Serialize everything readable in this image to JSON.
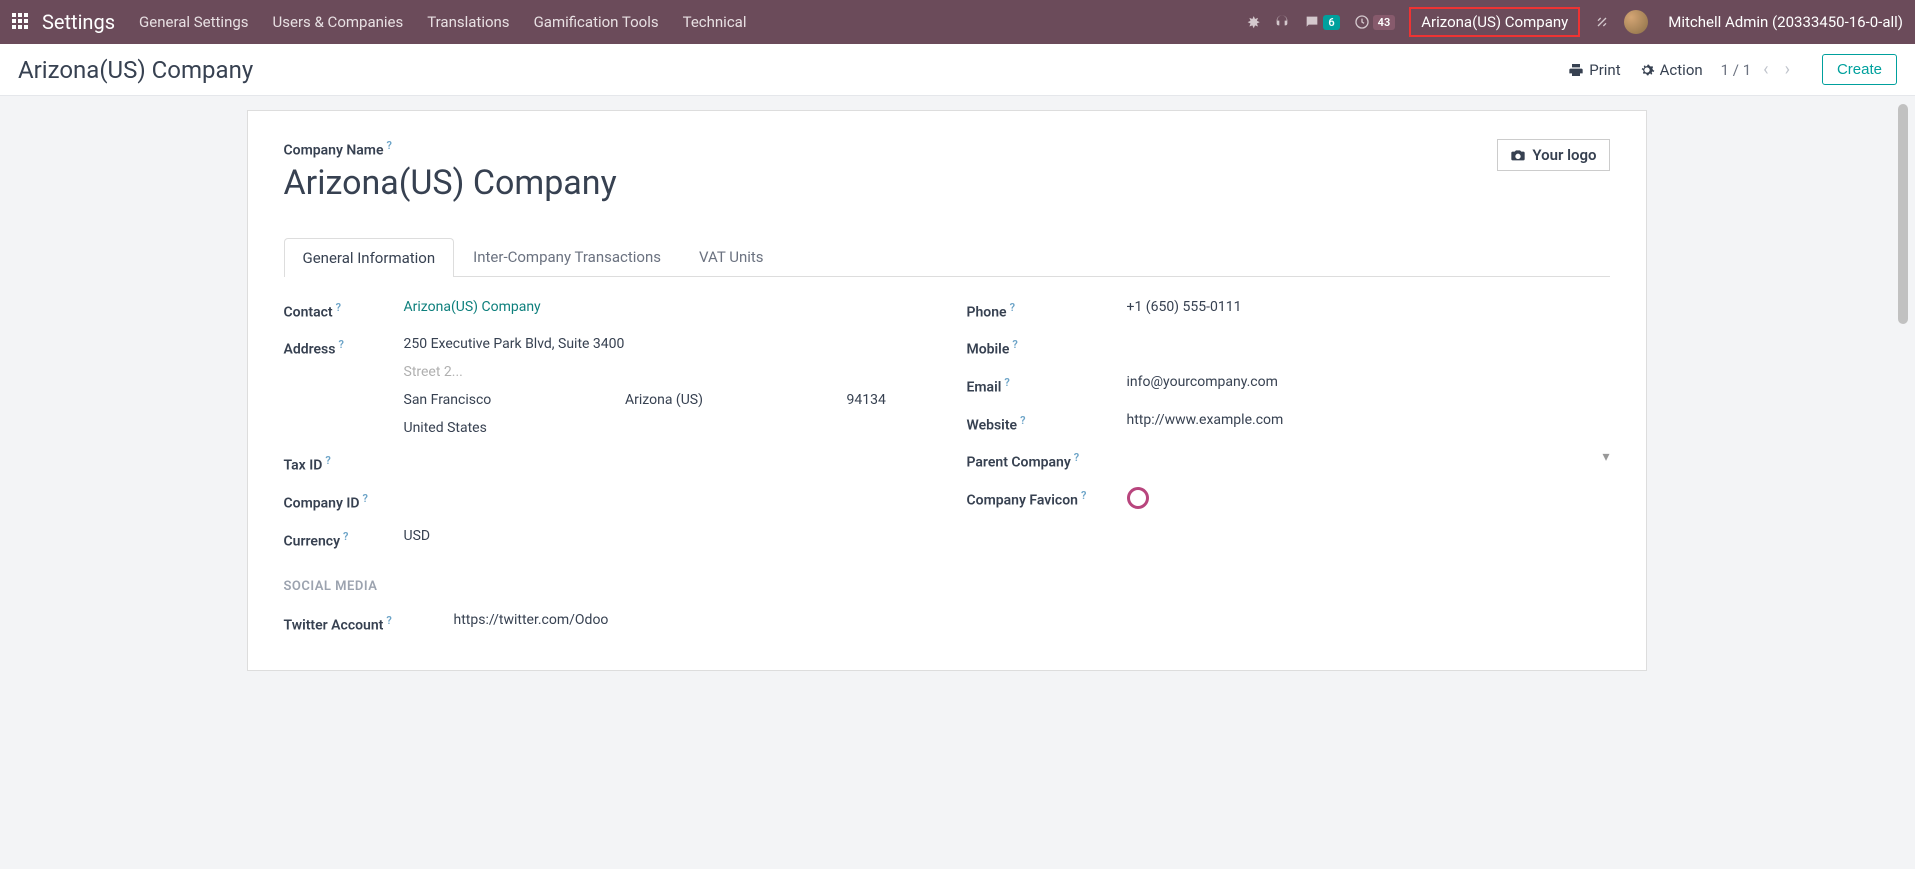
{
  "topbar": {
    "brand": "Settings",
    "menu": [
      "General Settings",
      "Users & Companies",
      "Translations",
      "Gamification Tools",
      "Technical"
    ],
    "chat_badge": "6",
    "clock_badge": "43",
    "company": "Arizona(US) Company",
    "user": "Mitchell Admin (20333450-16-0-all)"
  },
  "toolbar": {
    "breadcrumb": "Arizona(US) Company",
    "print": "Print",
    "action": "Action",
    "pager": "1 / 1",
    "create": "Create"
  },
  "form": {
    "company_name_label": "Company Name",
    "company_name": "Arizona(US) Company",
    "logo_btn": "Your logo",
    "tabs": [
      "General Information",
      "Inter-Company Transactions",
      "VAT Units"
    ],
    "left": {
      "contact_label": "Contact",
      "contact_value": "Arizona(US) Company",
      "address_label": "Address",
      "street": "250 Executive Park Blvd, Suite 3400",
      "street2_placeholder": "Street 2...",
      "city": "San Francisco",
      "state": "Arizona (US)",
      "zip": "94134",
      "country": "United States",
      "tax_id_label": "Tax ID",
      "company_id_label": "Company ID",
      "currency_label": "Currency",
      "currency_value": "USD"
    },
    "right": {
      "phone_label": "Phone",
      "phone_value": "+1 (650) 555-0111",
      "mobile_label": "Mobile",
      "email_label": "Email",
      "email_value": "info@yourcompany.com",
      "website_label": "Website",
      "website_value": "http://www.example.com",
      "parent_label": "Parent Company",
      "favicon_label": "Company Favicon"
    },
    "social": {
      "header": "SOCIAL MEDIA",
      "twitter_label": "Twitter Account",
      "twitter_value": "https://twitter.com/Odoo"
    }
  }
}
